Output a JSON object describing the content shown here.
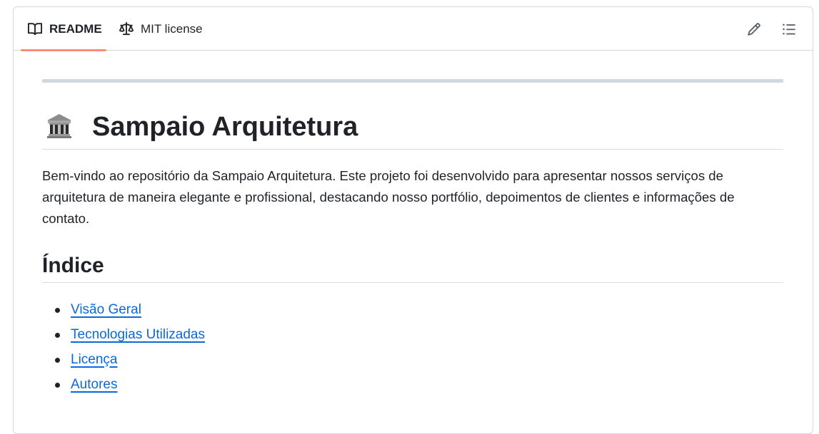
{
  "tabs": {
    "readme": {
      "label": "README",
      "icon": "book-icon"
    },
    "license": {
      "label": "MIT license",
      "icon": "law-scale-icon"
    }
  },
  "actions": {
    "edit": {
      "icon": "pencil-icon"
    },
    "toc": {
      "icon": "list-unordered-icon"
    }
  },
  "readme": {
    "title_emoji": "classical-building-icon",
    "title": "Sampaio Arquitetura",
    "intro": "Bem-vindo ao repositório da Sampaio Arquitetura. Este projeto foi desenvolvido para apresentar nossos serviços de arquitetura de maneira elegante e profissional, destacando nosso portfólio, depoimentos de clientes e informações de contato.",
    "index_heading": "Índice",
    "index_items": [
      {
        "label": "Visão Geral"
      },
      {
        "label": "Tecnologias Utilizadas"
      },
      {
        "label": "Licença"
      },
      {
        "label": "Autores"
      }
    ]
  },
  "colors": {
    "link": "#0969da",
    "active_tab_underline": "#fd8c73",
    "border": "#d1d9e0",
    "text": "#1f2328"
  }
}
